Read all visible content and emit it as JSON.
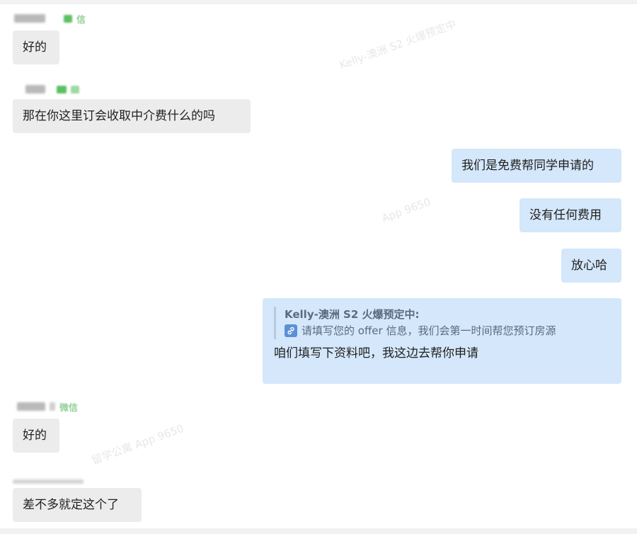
{
  "chat": {
    "messages": [
      {
        "text": "好的"
      },
      {
        "text": "那在你这里订会收取中介费什么的吗"
      },
      {
        "text": "我们是免费帮同学申请的"
      },
      {
        "text": "没有任何费用"
      },
      {
        "text": "放心哈"
      },
      {
        "quote_author": "Kelly-澳洲 S2 火爆预定中:",
        "quote_text": "请填写您的 offer 信息，我们会第一时间帮您预订房源",
        "text": "咱们填写下资料吧，我这边去帮你申请"
      },
      {
        "text": "好的"
      },
      {
        "text": "差不多就定这个了"
      }
    ],
    "sender_tags": [
      "信",
      "微信"
    ]
  },
  "watermark": {
    "text_1": "Kelly-澳洲 S2 火爆预定中",
    "text_2": "App 9650",
    "text_3": "留学公寓 App 9650"
  },
  "colors": {
    "incoming_bubble": "#ececec",
    "outgoing_bubble": "#d4e7fb",
    "link_icon": "#5d8fd6",
    "sender_green": "#52b45a"
  },
  "icons": {
    "quote_link": "link-icon"
  }
}
